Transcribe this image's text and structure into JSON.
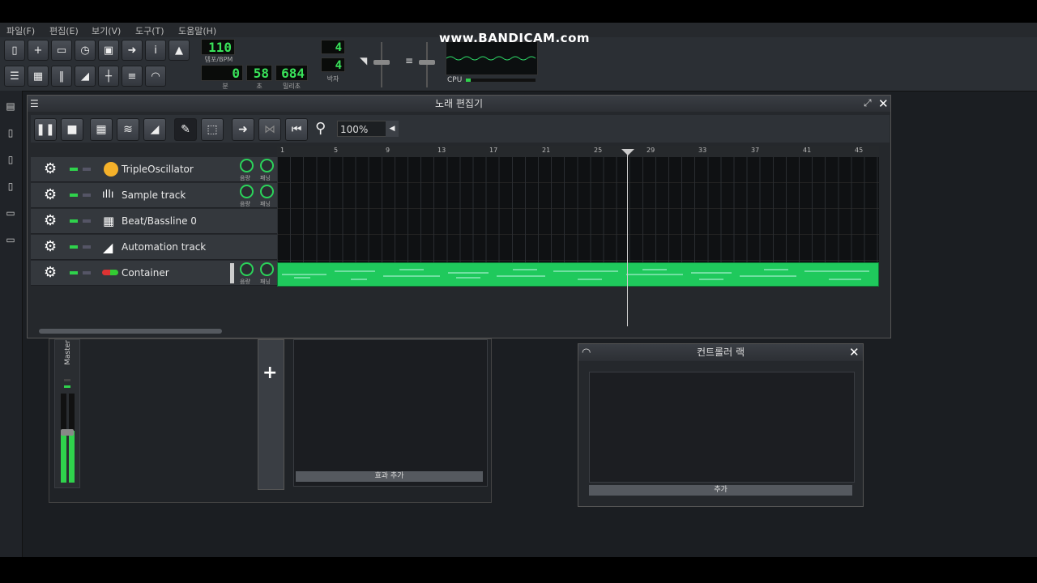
{
  "menu": [
    "파일(F)",
    "편집(E)",
    "보기(V)",
    "도구(T)",
    "도움말(H)"
  ],
  "watermark": "www.BANDICAM.com",
  "tempo": {
    "value": "110",
    "label": "템포/BPM"
  },
  "time": {
    "min": "0",
    "sec": "58",
    "ms": "684",
    "min_label": "분",
    "sec_label": "초",
    "ms_label": "밀리초"
  },
  "timesig": {
    "num": "4",
    "den": "4",
    "label": "박자"
  },
  "cpu_label": "CPU",
  "song_editor": {
    "title": "노래 편집기",
    "zoom": "100%",
    "ruler": [
      "1",
      "5",
      "9",
      "13",
      "17",
      "21",
      "25",
      "29",
      "33",
      "37",
      "41",
      "45"
    ],
    "tracks": [
      {
        "name": "TripleOscillator",
        "icon": "triple-oscillator-icon",
        "vol": "음량",
        "pan": "패닝"
      },
      {
        "name": "Sample track",
        "icon": "waveform-icon",
        "vol": "음량",
        "pan": "패닝"
      },
      {
        "name": "Beat/Bassline 0",
        "icon": "beat-grid-icon"
      },
      {
        "name": "Automation track",
        "icon": "automation-ramp-icon"
      },
      {
        "name": "Container",
        "icon": "instrument-plugin-icon",
        "vol": "음량",
        "pan": "패닝"
      }
    ]
  },
  "mixer": {
    "master_label": "Master",
    "add_effect": "효과 추가"
  },
  "controller_rack": {
    "title": "컨트롤러 랙",
    "add": "추가"
  },
  "colors": {
    "accent_green": "#1fc95c",
    "lcd_green": "#39e35a"
  }
}
